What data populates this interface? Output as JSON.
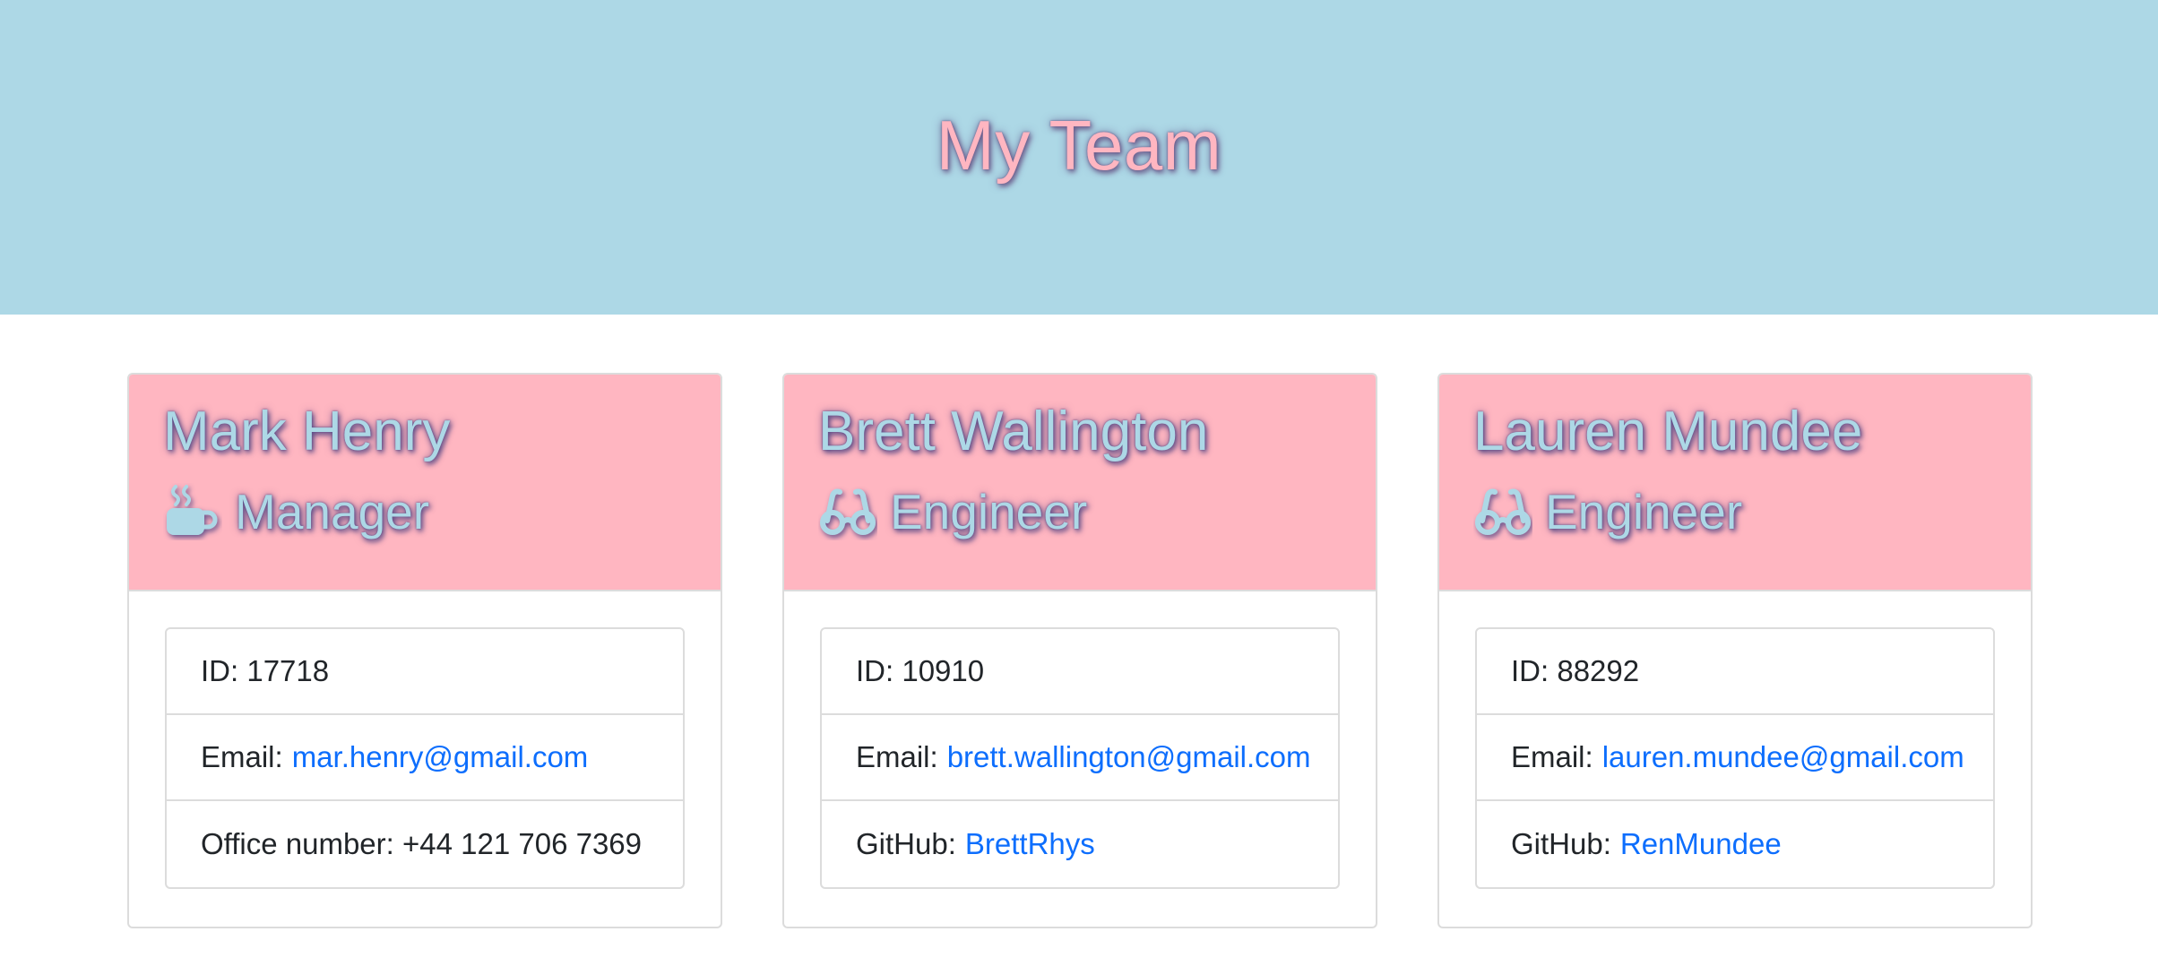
{
  "header": {
    "title": "My Team"
  },
  "team": [
    {
      "name": "Mark Henry",
      "role": "Manager",
      "role_icon": "coffee-cup-icon",
      "id_label": "ID:",
      "id": "17718",
      "email_label": "Email:",
      "email": "mar.henry@gmail.com",
      "extra_label": "Office number:",
      "extra_value": "+44 121 706 7369"
    },
    {
      "name": "Brett Wallington",
      "role": "Engineer",
      "role_icon": "glasses-icon",
      "id_label": "ID:",
      "id": "10910",
      "email_label": "Email:",
      "email": "brett.wallington@gmail.com",
      "extra_label": "GitHub:",
      "extra_value": "BrettRhys"
    },
    {
      "name": "Lauren Mundee",
      "role": "Engineer",
      "role_icon": "glasses-icon",
      "id_label": "ID:",
      "id": "88292",
      "email_label": "Email:",
      "email": "lauren.mundee@gmail.com",
      "extra_label": "GitHub:",
      "extra_value": "RenMundee"
    }
  ],
  "colors": {
    "header_bg": "#add8e6",
    "card_head_bg": "#ffb6c1",
    "link": "#0d6efd",
    "text": "#212529"
  }
}
